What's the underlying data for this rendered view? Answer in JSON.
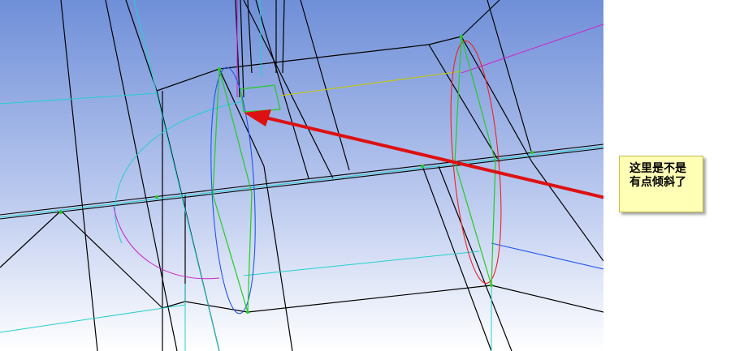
{
  "viewport": {
    "background_top": "#6f8fd8",
    "background_bottom": "#ffffff"
  },
  "annotation": {
    "text": "这里是不是\n有点倾斜了",
    "arrow_color": "#dd1111",
    "box_color": "#ffffb5"
  },
  "mesh_colors": {
    "edge": "#000000",
    "cyan": "#22d0d0",
    "green": "#22cc22",
    "magenta": "#cc22cc",
    "red": "#ee2222",
    "blue": "#2255ee",
    "yellow": "#c8c800"
  }
}
